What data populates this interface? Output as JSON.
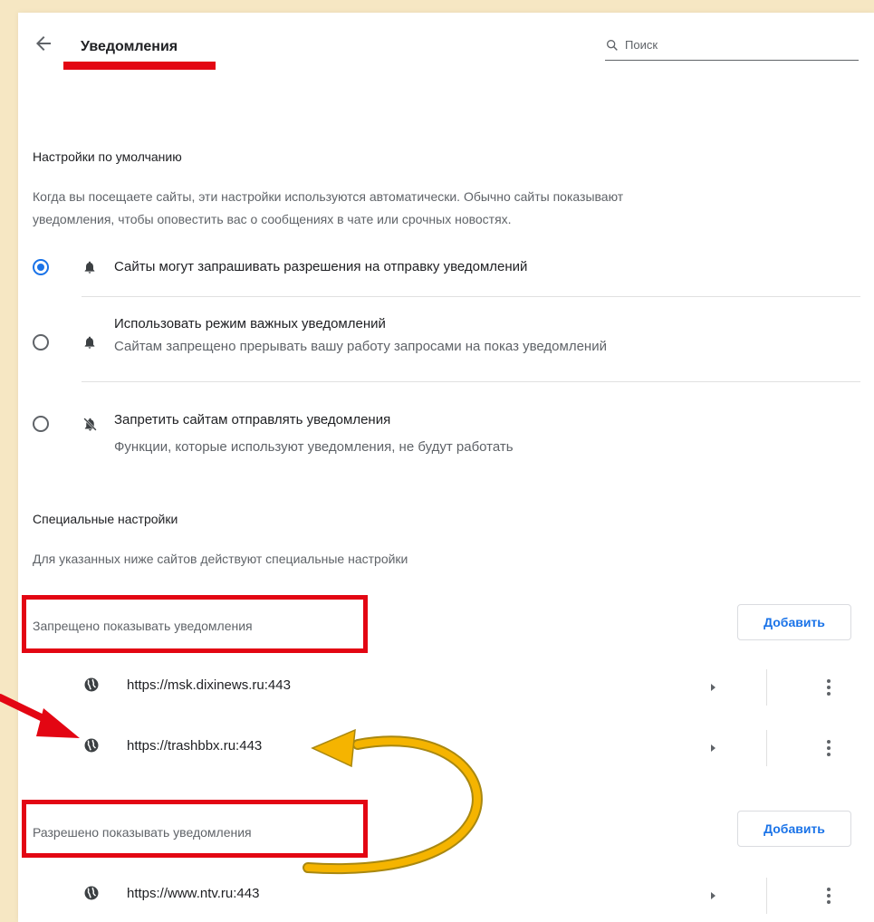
{
  "header": {
    "title": "Уведомления",
    "search_placeholder": "Поиск"
  },
  "defaults": {
    "heading": "Настройки по умолчанию",
    "description_line1": "Когда вы посещаете сайты, эти настройки используются автоматически. Обычно сайты показывают",
    "description_line2": "уведомления, чтобы оповестить вас о сообщениях в чате или срочных новостях.",
    "options": [
      {
        "title": "Сайты могут запрашивать разрешения на отправку уведомлений",
        "subtitle": "",
        "selected": true,
        "icon": "bell-icon"
      },
      {
        "title": "Использовать режим важных уведомлений",
        "subtitle": "Сайтам запрещено прерывать вашу работу запросами на показ уведомлений",
        "selected": false,
        "icon": "bell-icon"
      },
      {
        "title": "Запретить сайтам отправлять уведомления",
        "subtitle": "Функции, которые используют уведомления, не будут работать",
        "selected": false,
        "icon": "bell-off-icon"
      }
    ]
  },
  "custom": {
    "heading": "Специальные настройки",
    "description": "Для указанных ниже сайтов действуют специальные настройки",
    "blocked": {
      "label": "Запрещено показывать уведомления",
      "add_label": "Добавить",
      "sites": [
        "https://msk.dixinews.ru:443",
        "https://trashbbx.ru:443"
      ]
    },
    "allowed": {
      "label": "Разрешено показывать уведомления",
      "add_label": "Добавить",
      "sites": [
        "https://www.ntv.ru:443"
      ]
    }
  },
  "colors": {
    "accent": "#1a73e8",
    "annotation_red": "#e30613",
    "annotation_arrow_yellow": "#f5b400",
    "background": "#f6e7c3"
  }
}
